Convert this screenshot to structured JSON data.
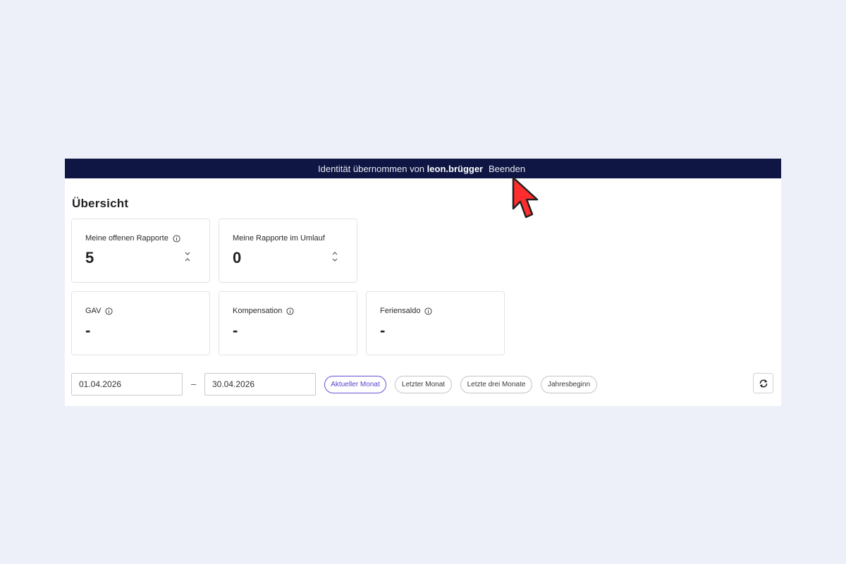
{
  "banner": {
    "prefix": "Identität übernommen von",
    "user": "leon.brügger",
    "end_label": "Beenden"
  },
  "page": {
    "title": "Übersicht"
  },
  "cards": [
    {
      "label": "Meine offenen Rapporte",
      "value": "5",
      "has_info": true,
      "icon": "chevrons-collapse-icon"
    },
    {
      "label": "Meine Rapporte im Umlauf",
      "value": "0",
      "has_info": false,
      "icon": "chevrons-expand-icon"
    },
    {
      "label": "GAV",
      "value": "-",
      "has_info": true
    },
    {
      "label": "Kompensation",
      "value": "-",
      "has_info": true
    },
    {
      "label": "Feriensaldo",
      "value": "-",
      "has_info": true
    }
  ],
  "filter": {
    "date_from": "01.04.2026",
    "separator": "–",
    "date_to": "30.04.2026",
    "chips": [
      {
        "label": "Aktueller Monat",
        "active": true
      },
      {
        "label": "Letzter Monat",
        "active": false
      },
      {
        "label": "Letzte drei Monate",
        "active": false
      },
      {
        "label": "Jahresbeginn",
        "active": false
      }
    ],
    "refresh_icon": "refresh-icon"
  },
  "colors": {
    "banner_bg": "#0f1644",
    "accent": "#5b3fd0",
    "page_bg": "#edf0f8",
    "cursor": "#ff2d2d"
  }
}
